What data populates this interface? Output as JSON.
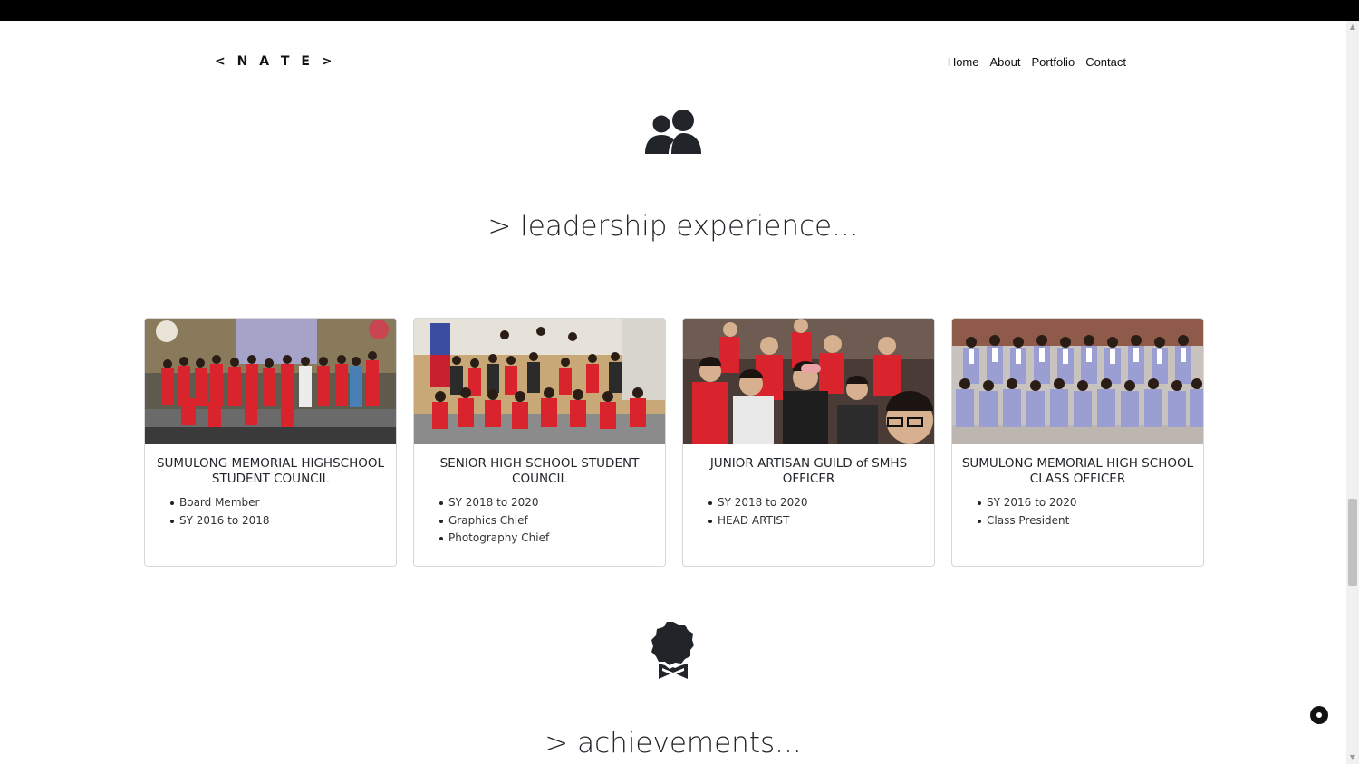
{
  "brand": "< N A T E >",
  "nav": {
    "items": [
      "Home",
      "About",
      "Portfolio",
      "Contact"
    ]
  },
  "icons": {
    "leadership": "users-icon",
    "achievements": "award-icon"
  },
  "colors": {
    "topbar": "#000000",
    "text": "#212529",
    "card_border": "#d7d7d7",
    "team_red": "#d9232d",
    "uniform_lavender": "#9b9ed3"
  },
  "leadership": {
    "heading": "> leadership experience...",
    "cards": [
      {
        "title": "SUMULONG MEMORIAL HIGHSCHOOL STUDENT COUNCIL",
        "items": [
          "Board Member",
          "SY 2016 to 2018"
        ]
      },
      {
        "title": "SENIOR HIGH SCHOOL STUDENT COUNCIL",
        "items": [
          "SY 2018 to 2020",
          "Graphics Chief",
          "Photography Chief"
        ]
      },
      {
        "title": "JUNIOR ARTISAN GUILD of SMHS OFFICER",
        "items": [
          "SY 2018 to 2020",
          "HEAD ARTIST"
        ]
      },
      {
        "title": "SUMULONG MEMORIAL HIGH SCHOOL CLASS OFFICER",
        "items": [
          "SY 2016 to 2020",
          "Class President"
        ]
      }
    ]
  },
  "achievements": {
    "heading": "> achievements..."
  }
}
